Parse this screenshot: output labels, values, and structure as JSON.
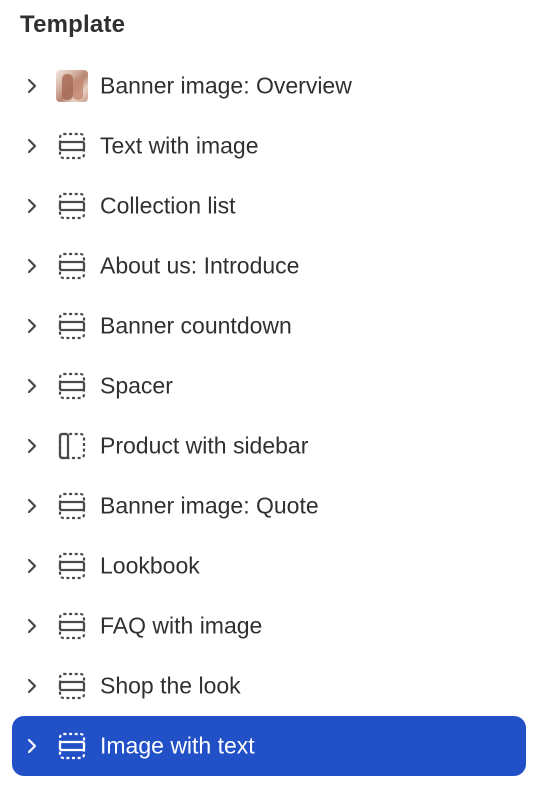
{
  "panel": {
    "title": "Template"
  },
  "colors": {
    "text": "#303030",
    "icon": "#4a4a4a",
    "selected_bg": "#2250c7",
    "selected_text": "#ffffff"
  },
  "items": [
    {
      "label": "Banner image: Overview",
      "icon": "image-thumbnail",
      "selected": false
    },
    {
      "label": "Text with image",
      "icon": "section-icon",
      "selected": false
    },
    {
      "label": "Collection list",
      "icon": "section-icon",
      "selected": false
    },
    {
      "label": "About us: Introduce",
      "icon": "section-icon",
      "selected": false
    },
    {
      "label": "Banner countdown",
      "icon": "section-icon",
      "selected": false
    },
    {
      "label": "Spacer",
      "icon": "section-icon",
      "selected": false
    },
    {
      "label": "Product with sidebar",
      "icon": "sidebar-layout-icon",
      "selected": false
    },
    {
      "label": "Banner image: Quote",
      "icon": "section-icon",
      "selected": false
    },
    {
      "label": "Lookbook",
      "icon": "section-icon",
      "selected": false
    },
    {
      "label": "FAQ with image",
      "icon": "section-icon",
      "selected": false
    },
    {
      "label": "Shop the look",
      "icon": "section-icon",
      "selected": false
    },
    {
      "label": "Image with text",
      "icon": "section-icon",
      "selected": true
    }
  ]
}
